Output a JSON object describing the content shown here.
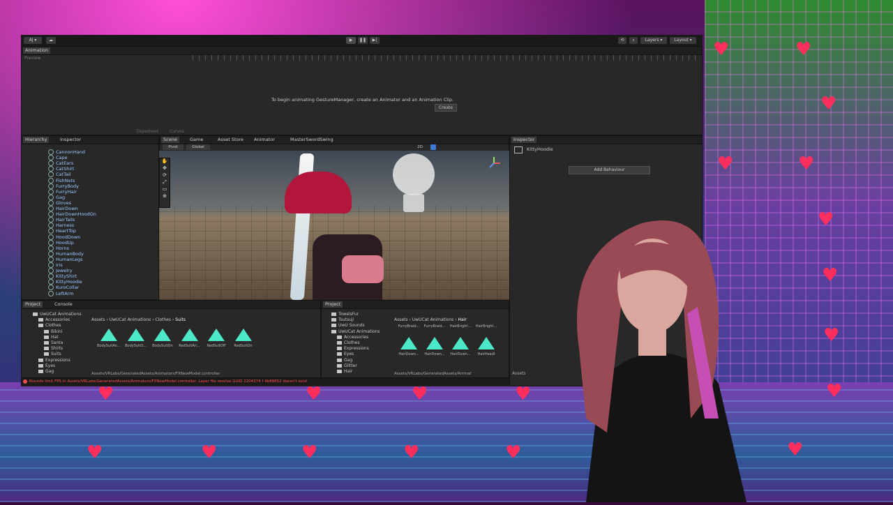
{
  "colors": {
    "accent": "#4de8c8",
    "error": "#ff4d4d",
    "link": "#9fc7ff"
  },
  "unity": {
    "account": "AJ",
    "layers": "Layers",
    "layout": "Layout",
    "animation": {
      "tab": "Animation",
      "preview": "Preview",
      "message": "To begin animating GestureManager, create an Animator and an Animation Clip.",
      "create": "Create",
      "dopesheet": "Dopesheet",
      "curves": "Curves"
    },
    "hierarchy": {
      "tabs": [
        "Hierarchy",
        "Inspector"
      ],
      "items": [
        "CannonHand",
        "Cape",
        "CatEars",
        "CatShirt",
        "CatTail",
        "FishNets",
        "FurryBody",
        "FurryHair",
        "Gag",
        "Gloves",
        "HairDown",
        "HairDownHoodOn",
        "HairTails",
        "Harness",
        "HeartTop",
        "HoodDown",
        "HoodUp",
        "Horns",
        "HumanBody",
        "HumanLegs",
        "Iris",
        "Jewelry",
        "KittyShirt",
        "KittyHoodie",
        "KuroCollar",
        "LeftArm"
      ]
    },
    "scene": {
      "tabs": [
        "Scene",
        "Game",
        "Asset Store",
        "Animator",
        "MasterSwordSwing"
      ],
      "pivot": "Pivot",
      "global": "Global",
      "mode2d": "2D"
    },
    "inspector": {
      "tab": "Inspector",
      "object": "KittyHoodie",
      "add_behaviour": "Add Behaviour"
    },
    "project_left": {
      "tabs": [
        "Project",
        "Console"
      ],
      "tree": [
        "UwUCat Animations",
        "Accessories",
        "Clothes",
        "Bikini",
        "Hat",
        "Santa",
        "Shirts",
        "Suits",
        "Expressions",
        "Eyes",
        "Gag"
      ],
      "breadcrumb": [
        "Assets",
        "UwUCat Animations",
        "Clothes",
        "Suits"
      ],
      "assets": [
        "BodySuitAn...",
        "BodySuitO...",
        "BodySuitOn",
        "RedSuitAn...",
        "RedSuitOff",
        "RedSuitOn"
      ],
      "path": "Assets/VRLabs/GeneratedAssets/Animators/FXNewModel.controller"
    },
    "project_right": {
      "tab": "Project",
      "tree": [
        "TowelsFur",
        "Tsutsuji",
        "UwU Sounds",
        "UwUCat Animations",
        "Accessories",
        "Clothes",
        "Expressions",
        "Eyes",
        "Gag",
        "Glitter",
        "Hair"
      ],
      "breadcrumb": [
        "Assets",
        "UwUCat Animations",
        "Hair"
      ],
      "labels_top": [
        "FurryBraid...",
        "FurryBraid...",
        "HairBright...",
        "HairBright..."
      ],
      "assets": [
        "HairDown...",
        "HairDown...",
        "HairDown...",
        "HairHeadI"
      ],
      "path": "Assets/VRLabs/GeneratedAssets/Animat",
      "assets_label": "Assets"
    },
    "status_error": "Bounds limit FPS in Assets/VRLabs/GeneratedAssets/Animators/FXNewModel.controller: Layer file resolve GUID 2204374 f 4b88652 doesn't exist"
  }
}
